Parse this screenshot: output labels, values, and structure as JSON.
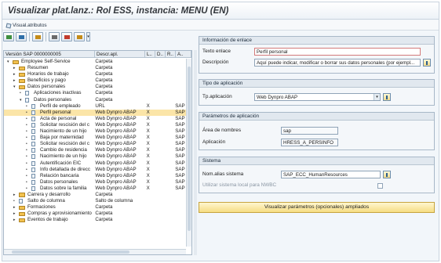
{
  "window": {
    "title": "Visualizar plat.lanz.: Rol ESS, instancia: MENU (EN)"
  },
  "menubar": {
    "visual_attributes": "Visual.atributos"
  },
  "toolbar": {
    "icons": [
      "toggle-icon",
      "collapse-icon",
      "hierarchy-icon",
      "copy-icon",
      "delete-icon",
      "layout-icon"
    ]
  },
  "tree": {
    "headers": [
      "Versión SAP 0000000005",
      "Descr.apl.",
      "L..",
      "D..",
      "R..",
      "A.."
    ],
    "rows": [
      {
        "indent": 0,
        "exp": "▾",
        "icon": "folder",
        "name": "Employee Self-Service",
        "desc": "Carpeta",
        "l": "",
        "d": "",
        "r": "",
        "s": ""
      },
      {
        "indent": 1,
        "exp": "▸",
        "icon": "folder",
        "name": "Resumen",
        "desc": "Carpeta",
        "l": "",
        "d": "",
        "r": "",
        "s": ""
      },
      {
        "indent": 1,
        "exp": "▸",
        "icon": "folder",
        "name": "Horarios de trabajo",
        "desc": "Carpeta",
        "l": "",
        "d": "",
        "r": "",
        "s": ""
      },
      {
        "indent": 1,
        "exp": "▸",
        "icon": "folder",
        "name": "Beneficios y pago",
        "desc": "Carpeta",
        "l": "",
        "d": "",
        "r": "",
        "s": ""
      },
      {
        "indent": 1,
        "exp": "▾",
        "icon": "folder",
        "name": "Datos personales",
        "desc": "Carpeta",
        "l": "",
        "d": "",
        "r": "",
        "s": ""
      },
      {
        "indent": 2,
        "exp": "•",
        "icon": "doc",
        "name": "Aplicaciones inactivas",
        "desc": "Carpeta",
        "l": "",
        "d": "",
        "r": "",
        "s": ""
      },
      {
        "indent": 2,
        "exp": "▾",
        "icon": "doc",
        "name": "Datos personales",
        "desc": "Carpeta",
        "l": "",
        "d": "",
        "r": "",
        "s": ""
      },
      {
        "indent": 3,
        "exp": "•",
        "icon": "doc",
        "name": "Perfil de empleado",
        "desc": "URL",
        "l": "X",
        "d": "",
        "r": "",
        "s": "SAP"
      },
      {
        "indent": 3,
        "exp": "•",
        "icon": "doc",
        "name": "Perfil personal",
        "desc": "Web Dynpro ABAP",
        "l": "X",
        "d": "",
        "r": "",
        "s": "SAP",
        "selected": true
      },
      {
        "indent": 3,
        "exp": "•",
        "icon": "doc",
        "name": "Acta de personal",
        "desc": "Web Dynpro ABAP",
        "l": "X",
        "d": "",
        "r": "",
        "s": "SAP"
      },
      {
        "indent": 3,
        "exp": "•",
        "icon": "doc",
        "name": "Solicitar rescisión del c",
        "desc": "Web Dynpro ABAP",
        "l": "X",
        "d": "",
        "r": "",
        "s": "SAP"
      },
      {
        "indent": 3,
        "exp": "•",
        "icon": "doc",
        "name": "Nacimiento de un hijo",
        "desc": "Web Dynpro ABAP",
        "l": "X",
        "d": "",
        "r": "",
        "s": "SAP"
      },
      {
        "indent": 3,
        "exp": "•",
        "icon": "doc",
        "name": "Baja por maternidad",
        "desc": "Web Dynpro ABAP",
        "l": "X",
        "d": "",
        "r": "",
        "s": "SAP"
      },
      {
        "indent": 3,
        "exp": "•",
        "icon": "doc",
        "name": "Solicitar rescisión del c",
        "desc": "Web Dynpro ABAP",
        "l": "X",
        "d": "",
        "r": "",
        "s": "SAP"
      },
      {
        "indent": 3,
        "exp": "•",
        "icon": "doc",
        "name": "Cambio de residencia",
        "desc": "Web Dynpro ABAP",
        "l": "X",
        "d": "",
        "r": "",
        "s": "SAP"
      },
      {
        "indent": 3,
        "exp": "•",
        "icon": "doc",
        "name": "Nacimiento de un hijo",
        "desc": "Web Dynpro ABAP",
        "l": "X",
        "d": "",
        "r": "",
        "s": "SAP"
      },
      {
        "indent": 3,
        "exp": "•",
        "icon": "doc",
        "name": "Autentificación EIC",
        "desc": "Web Dynpro ABAP",
        "l": "X",
        "d": "",
        "r": "",
        "s": "SAP"
      },
      {
        "indent": 3,
        "exp": "•",
        "icon": "doc",
        "name": "Info detallada de direcc",
        "desc": "Web Dynpro ABAP",
        "l": "X",
        "d": "",
        "r": "",
        "s": "SAP"
      },
      {
        "indent": 3,
        "exp": "•",
        "icon": "doc",
        "name": "Relación bancaria",
        "desc": "Web Dynpro ABAP",
        "l": "X",
        "d": "",
        "r": "",
        "s": "SAP"
      },
      {
        "indent": 3,
        "exp": "•",
        "icon": "doc",
        "name": "Datos personales",
        "desc": "Web Dynpro ABAP",
        "l": "X",
        "d": "",
        "r": "",
        "s": "SAP"
      },
      {
        "indent": 3,
        "exp": "•",
        "icon": "doc",
        "name": "Datos sobre la familia",
        "desc": "Web Dynpro ABAP",
        "l": "X",
        "d": "",
        "r": "",
        "s": "SAP"
      },
      {
        "indent": 1,
        "exp": "▸",
        "icon": "folder",
        "name": "Carrera y desarrollo",
        "desc": "Carpeta",
        "l": "",
        "d": "",
        "r": "",
        "s": ""
      },
      {
        "indent": 1,
        "exp": "•",
        "icon": "doc",
        "name": "Salto de columna",
        "desc": "Salto de columna",
        "l": "",
        "d": "",
        "r": "",
        "s": ""
      },
      {
        "indent": 1,
        "exp": "▸",
        "icon": "folder",
        "name": "Formaciones",
        "desc": "Carpeta",
        "l": "",
        "d": "",
        "r": "",
        "s": ""
      },
      {
        "indent": 1,
        "exp": "▸",
        "icon": "folder",
        "name": "Compras y aprovisionamiento",
        "desc": "Carpeta",
        "l": "",
        "d": "",
        "r": "",
        "s": ""
      },
      {
        "indent": 1,
        "exp": "▸",
        "icon": "folder",
        "name": "Eventos de trabajo",
        "desc": "Carpeta",
        "l": "",
        "d": "",
        "r": "",
        "s": ""
      }
    ]
  },
  "link_info": {
    "header": "Información de enlace",
    "text_label": "Texto enlace",
    "text_value": "Perfil personal",
    "desc_label": "Descripción",
    "desc_value": "Aquí puede indicar, modificar o borrar sus datos personales (por ejempl..."
  },
  "app_type": {
    "header": "Tipo de aplicación",
    "label": "Tp.aplicación",
    "value": "Web Dynpro ABAP"
  },
  "app_params": {
    "header": "Parámetros de aplicación",
    "namespace_label": "Área de nombres",
    "namespace_value": "sap",
    "app_label": "Aplicación",
    "app_value": "HRESS_A_PERSINFO"
  },
  "system": {
    "header": "Sistema",
    "alias_label": "Nom.alias sistema",
    "alias_value": "SAP_ECC_HumanResources",
    "local_label": "Utilizar sistema local para NWBC",
    "local_checked": false
  },
  "actions": {
    "show_params": "Visualizar parámetros (opcionales) ampliados"
  },
  "colors": {
    "selected_row": "#fbe5a8",
    "button_yellow": "#f6dd83",
    "header_bg": "#e1e8ef"
  }
}
